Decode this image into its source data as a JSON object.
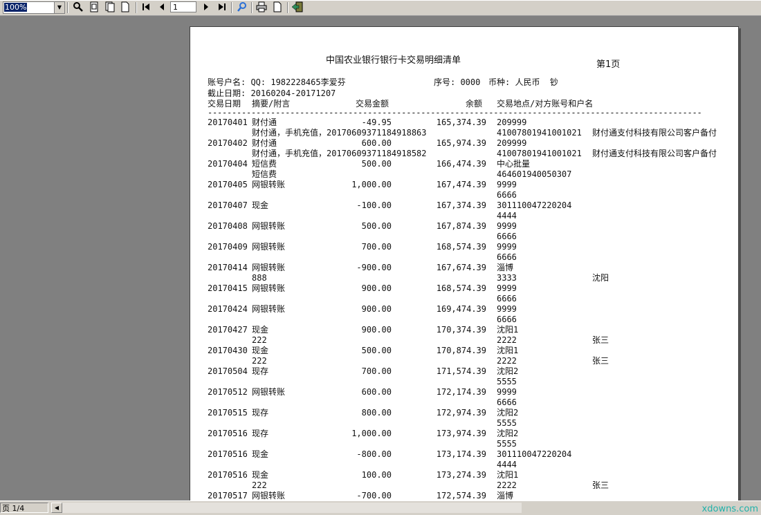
{
  "toolbar": {
    "zoom": "100%",
    "page_input": "1"
  },
  "report": {
    "title": "中国农业银行银行卡交易明细清单",
    "page_no": "第1页",
    "account_line": "账号户名: QQ: 1982228465李爱芬",
    "serial_line": "序号: 0000",
    "currency_line": "币种: 人民币  钞",
    "date_range": "截止日期: 20160204-20171207",
    "headers": {
      "date": "交易日期",
      "summary": "摘要/附言",
      "amount": "交易金额",
      "balance": "余额",
      "place": "交易地点/对方账号和户名"
    },
    "rule": "------------------------------------------------------------------------------------------------------------------",
    "rows": [
      {
        "date": "20170401",
        "summary": "财付通",
        "amount": "-49.95",
        "balance": "165,374.39",
        "place": "209999",
        "memo": "财付通，手机充值，20170609371184918863",
        "account": "41007801941001021",
        "name": "财付通支付科技有限公司客户备付"
      },
      {
        "date": "20170402",
        "summary": "财付通",
        "amount": "600.00",
        "balance": "165,974.39",
        "place": "209999",
        "memo": "财付通，手机充值，20170609371184918582",
        "account": "41007801941001021",
        "name": "财付通支付科技有限公司客户备付"
      },
      {
        "date": "20170404",
        "summary": "短信费",
        "amount": "500.00",
        "balance": "166,474.39",
        "place": "中心批量",
        "memo": "短信费",
        "account": "464601940050307",
        "name": ""
      },
      {
        "date": "20170405",
        "summary": "网银转账",
        "amount": "1,000.00",
        "balance": "167,474.39",
        "place": "9999",
        "memo": "",
        "account": "6666",
        "name": ""
      },
      {
        "date": "20170407",
        "summary": "现金",
        "amount": "-100.00",
        "balance": "167,374.39",
        "place": "301110047220204",
        "memo": "",
        "account": "4444",
        "name": ""
      },
      {
        "date": "20170408",
        "summary": "网银转账",
        "amount": "500.00",
        "balance": "167,874.39",
        "place": "9999",
        "memo": "",
        "account": "6666",
        "name": ""
      },
      {
        "date": "20170409",
        "summary": "网银转账",
        "amount": "700.00",
        "balance": "168,574.39",
        "place": "9999",
        "memo": "",
        "account": "6666",
        "name": ""
      },
      {
        "date": "20170414",
        "summary": "网银转账",
        "amount": "-900.00",
        "balance": "167,674.39",
        "place": "淄博",
        "memo": "888",
        "account": "3333",
        "name": "沈阳"
      },
      {
        "date": "20170415",
        "summary": "网银转账",
        "amount": "900.00",
        "balance": "168,574.39",
        "place": "9999",
        "memo": "",
        "account": "6666",
        "name": ""
      },
      {
        "date": "20170424",
        "summary": "网银转账",
        "amount": "900.00",
        "balance": "169,474.39",
        "place": "9999",
        "memo": "",
        "account": "6666",
        "name": ""
      },
      {
        "date": "20170427",
        "summary": "现金",
        "amount": "900.00",
        "balance": "170,374.39",
        "place": "沈阳1",
        "memo": "222",
        "account": "2222",
        "name": "张三"
      },
      {
        "date": "20170430",
        "summary": "现金",
        "amount": "500.00",
        "balance": "170,874.39",
        "place": "沈阳1",
        "memo": "222",
        "account": "2222",
        "name": "张三"
      },
      {
        "date": "20170504",
        "summary": "现存",
        "amount": "700.00",
        "balance": "171,574.39",
        "place": "沈阳2",
        "memo": "",
        "account": "5555",
        "name": ""
      },
      {
        "date": "20170512",
        "summary": "网银转账",
        "amount": "600.00",
        "balance": "172,174.39",
        "place": "9999",
        "memo": "",
        "account": "6666",
        "name": ""
      },
      {
        "date": "20170515",
        "summary": "现存",
        "amount": "800.00",
        "balance": "172,974.39",
        "place": "沈阳2",
        "memo": "",
        "account": "5555",
        "name": ""
      },
      {
        "date": "20170516",
        "summary": "现存",
        "amount": "1,000.00",
        "balance": "173,974.39",
        "place": "沈阳2",
        "memo": "",
        "account": "5555",
        "name": ""
      },
      {
        "date": "20170516",
        "summary": "现金",
        "amount": "-800.00",
        "balance": "173,174.39",
        "place": "301110047220204",
        "memo": "",
        "account": "4444",
        "name": ""
      },
      {
        "date": "20170516",
        "summary": "现金",
        "amount": "100.00",
        "balance": "173,274.39",
        "place": "沈阳1",
        "memo": "222",
        "account": "2222",
        "name": "张三"
      },
      {
        "date": "20170517",
        "summary": "网银转账",
        "amount": "-700.00",
        "balance": "172,574.39",
        "place": "淄博",
        "memo": "",
        "account": "",
        "name": ""
      }
    ]
  },
  "status": {
    "page": "页 1/4",
    "watermark": "xdowns.com"
  }
}
